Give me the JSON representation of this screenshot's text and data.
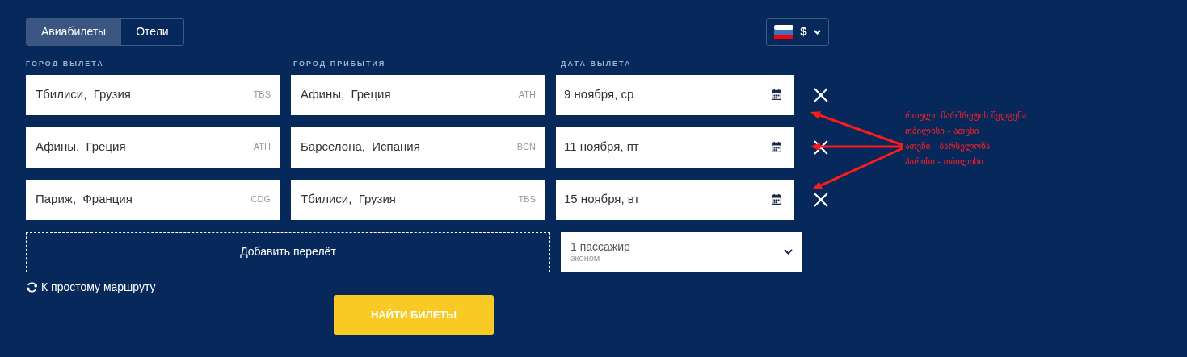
{
  "tabs": [
    {
      "label": "Авиабилеты",
      "selected": true
    },
    {
      "label": "Отели",
      "selected": false
    }
  ],
  "currency": {
    "symbol": "$"
  },
  "column_labels": [
    "ГОРОД ВЫЛЕТА",
    "ГОРОД ПРИБЫТИЯ",
    "ДАТА ВЫЛЕТА"
  ],
  "segments": [
    {
      "from": {
        "city": "Тбилиси,  Грузия",
        "code": "TBS"
      },
      "to": {
        "city": "Афины,  Греция",
        "code": "ATH"
      },
      "date": "9 ноября, ср"
    },
    {
      "from": {
        "city": "Афины,  Греция",
        "code": "ATH"
      },
      "to": {
        "city": "Барселона,  Испания",
        "code": "BCN"
      },
      "date": "11 ноября, пт"
    },
    {
      "from": {
        "city": "Париж,  Франция",
        "code": "CDG"
      },
      "to": {
        "city": "Тбилиси,  Грузия",
        "code": "TBS"
      },
      "date": "15 ноября, вт"
    }
  ],
  "add_flight_button": "Добавить перелёт",
  "passengers": {
    "count": "1 пассажир",
    "class": "эконом"
  },
  "simple_route_link": "К простому маршруту",
  "search_button": "НАЙТИ БИЛЕТЫ",
  "annotation": {
    "lines": [
      "რთული მარშრუტის შედგენა",
      "თბილისი - ათენი",
      "ათენი - ბარსელონა",
      "პარიზი - თბილისი"
    ]
  }
}
